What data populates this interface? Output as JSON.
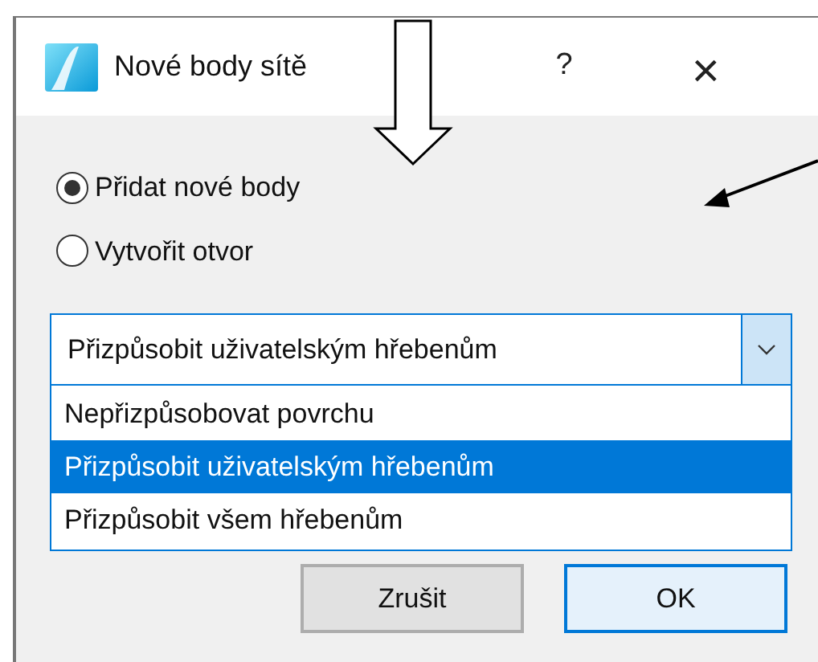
{
  "window": {
    "title": "Nové body sítě",
    "help": "?",
    "close": "×"
  },
  "radios": [
    {
      "label": "Přidat nové body",
      "selected": true
    },
    {
      "label": "Vytvořit otvor",
      "selected": false
    }
  ],
  "combo": {
    "value": "Přizpůsobit uživatelským hřebenům",
    "options": [
      {
        "label": "Nepřizpůsobovat povrchu",
        "selected": false
      },
      {
        "label": "Přizpůsobit uživatelským hřebenům",
        "selected": true
      },
      {
        "label": "Přizpůsobit všem hřebenům",
        "selected": false
      }
    ]
  },
  "buttons": [
    {
      "label": "Zrušit",
      "default": false
    },
    {
      "label": "OK",
      "default": true
    }
  ]
}
